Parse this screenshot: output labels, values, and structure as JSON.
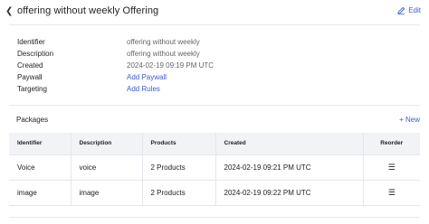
{
  "header": {
    "title": "offering without weekly Offering",
    "edit_label": "Edit"
  },
  "details": [
    {
      "label": "Identifier",
      "value": "offering without weekly",
      "link": false
    },
    {
      "label": "Description",
      "value": "offering without weekly",
      "link": false
    },
    {
      "label": "Created",
      "value": "2024-02-19 09:19 PM UTC",
      "link": false
    },
    {
      "label": "Paywall",
      "value": "Add Paywall",
      "link": true
    },
    {
      "label": "Targeting",
      "value": "Add Rules",
      "link": true
    }
  ],
  "packages": {
    "title": "Packages",
    "new_label": "+ New",
    "columns": [
      "Identifier",
      "Description",
      "Products",
      "Created",
      "Reorder"
    ],
    "rows": [
      {
        "identifier": "Voice",
        "description": "voice",
        "products": "2 Products",
        "created": "2024-02-19 09:21 PM UTC"
      },
      {
        "identifier": "image",
        "description": "image",
        "products": "2 Products",
        "created": "2024-02-19 09:22 PM UTC"
      }
    ]
  },
  "colors": {
    "accent": "#3b5bdb",
    "header_bg": "#f1f3f7",
    "border": "#e3e6ec"
  }
}
